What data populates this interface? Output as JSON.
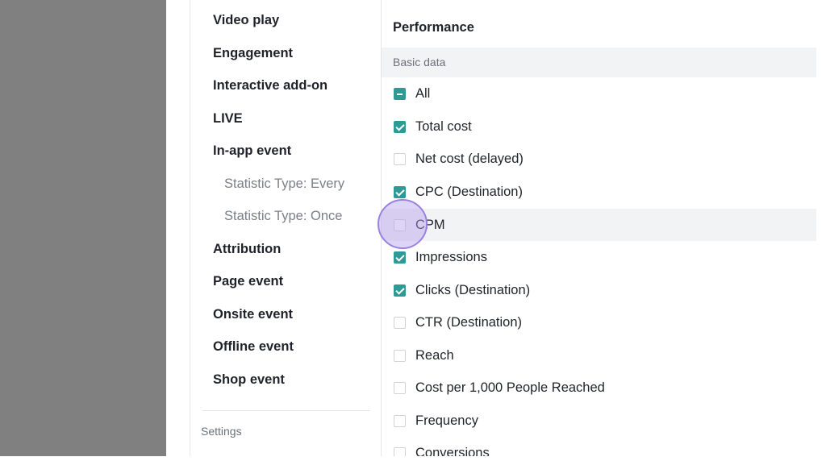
{
  "colors": {
    "accent": "#2c9b96",
    "backdrop": "#808080",
    "header_bg": "#f2f3f5",
    "click_indicator": "#9a82e0"
  },
  "sidebar": {
    "items": [
      {
        "label": "Video play"
      },
      {
        "label": "Engagement"
      },
      {
        "label": "Interactive add-on"
      },
      {
        "label": "LIVE"
      },
      {
        "label": "In-app event"
      },
      {
        "label": "Statistic Type: Every"
      },
      {
        "label": "Statistic Type: Once"
      },
      {
        "label": "Attribution"
      },
      {
        "label": "Page event"
      },
      {
        "label": "Onsite event"
      },
      {
        "label": "Offline event"
      },
      {
        "label": "Shop event"
      }
    ],
    "settings_label": "Settings"
  },
  "main": {
    "section_title": "Performance",
    "group_header": "Basic data",
    "metrics": [
      {
        "label": "All",
        "state": "partial"
      },
      {
        "label": "Total cost",
        "state": "checked"
      },
      {
        "label": "Net cost (delayed)",
        "state": "unchecked"
      },
      {
        "label": "CPC (Destination)",
        "state": "checked"
      },
      {
        "label": "CPM",
        "state": "unchecked"
      },
      {
        "label": "Impressions",
        "state": "checked"
      },
      {
        "label": "Clicks (Destination)",
        "state": "checked"
      },
      {
        "label": "CTR (Destination)",
        "state": "unchecked"
      },
      {
        "label": "Reach",
        "state": "unchecked"
      },
      {
        "label": "Cost per 1,000 People Reached",
        "state": "unchecked"
      },
      {
        "label": "Frequency",
        "state": "unchecked"
      },
      {
        "label": "Conversions",
        "state": "unchecked"
      }
    ]
  }
}
